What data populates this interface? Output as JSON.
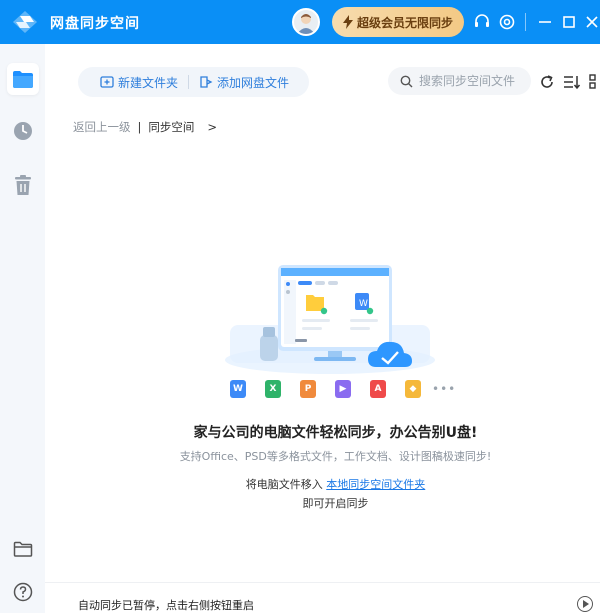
{
  "window": {
    "title": "网盘同步空间",
    "vip_label": "超级会员无限同步"
  },
  "toolbar": {
    "new_folder_label": "新建文件夹",
    "add_file_label": "添加网盘文件",
    "search_placeholder": "搜索同步空间文件"
  },
  "breadcrumb": {
    "back_label": "返回上一级",
    "current_label": "同步空间",
    "arrow": ">"
  },
  "empty_state": {
    "headline": "家与公司的电脑文件轻松同步，办公告别U盘!",
    "subline": "支持Office、PSD等多格式文件，工作文档、设计图稿极速同步!",
    "hint_prefix": "将电脑文件移入 ",
    "hint_link": "本地同步空间文件夹",
    "hint_line2": "即可开启同步"
  },
  "file_type_icons": [
    {
      "name": "word-icon",
      "color": "#3d8af7",
      "glyph": "W"
    },
    {
      "name": "excel-icon",
      "color": "#2fb36a",
      "glyph": "X"
    },
    {
      "name": "ppt-icon",
      "color": "#f08a3c",
      "glyph": "P"
    },
    {
      "name": "video-icon",
      "color": "#8a6cf0",
      "glyph": "▶"
    },
    {
      "name": "pdf-icon",
      "color": "#ef4a4a",
      "glyph": "A"
    },
    {
      "name": "image-icon",
      "color": "#f5b83a",
      "glyph": "◆"
    }
  ],
  "footer": {
    "status_text": "自动同步已暂停，点击右侧按钮重启"
  },
  "colors": {
    "brand_blue": "#0a8ff6",
    "vip_gold": "#f3c985",
    "link_blue": "#1a78e6"
  }
}
